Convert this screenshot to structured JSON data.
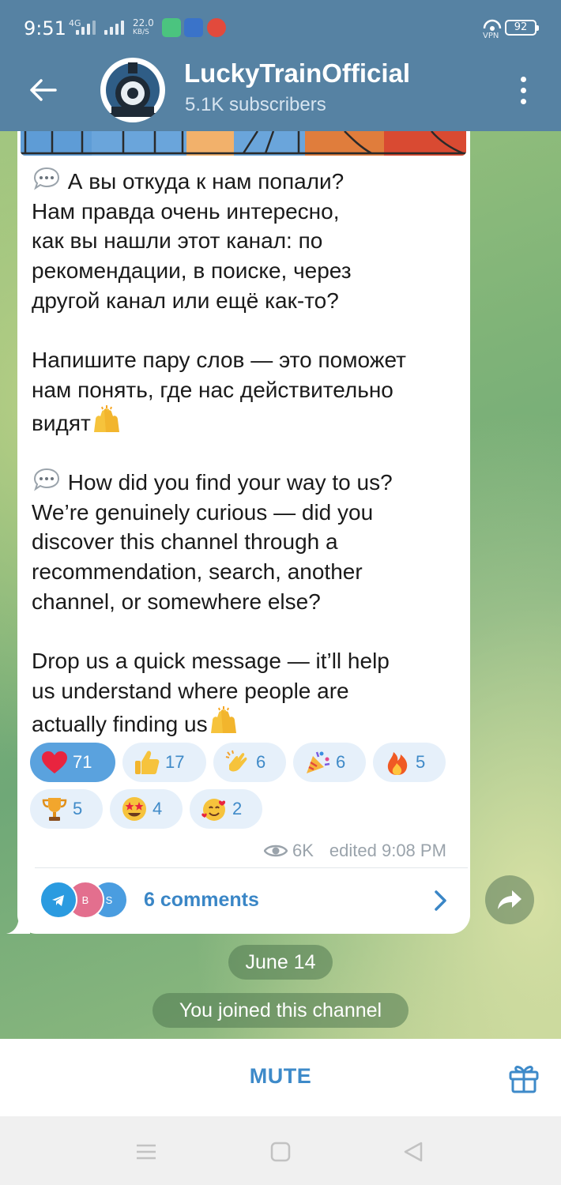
{
  "status_bar": {
    "time": "9:51",
    "network_type": "4G",
    "speed_value": "22.0",
    "speed_unit": "KB/S",
    "vpn_label": "VPN",
    "battery": "92"
  },
  "header": {
    "title": "LuckyTrainOfficial",
    "subtitle": "5.1K subscribers",
    "color": "#5682a3"
  },
  "message": {
    "paragraph_1": "А вы откуда к нам попали?\nНам правда очень интересно,\nкак вы нашли этот канал: по\nрекомендации, в поиске, через\nдругой канал или ещё как-то?",
    "paragraph_2": "Напишите пару слов — это поможет\nнам понять, где нас действительно\nвидят",
    "paragraph_3": "How did you find your way to us?\nWe’re genuinely curious — did you\ndiscover this channel through a\nrecommendation, search, another\nchannel, or somewhere else?",
    "paragraph_4": "Drop us a quick message — it’ll help\nus understand where people are\nactually finding us",
    "reactions": [
      {
        "icon": "heart",
        "count": "71",
        "active": true
      },
      {
        "icon": "thumbs-up",
        "count": "17"
      },
      {
        "icon": "clapping-hands",
        "count": "6"
      },
      {
        "icon": "party-popper",
        "count": "6"
      },
      {
        "icon": "fire",
        "count": "5"
      },
      {
        "icon": "trophy",
        "count": "5"
      },
      {
        "icon": "star-struck",
        "count": "4"
      },
      {
        "icon": "smiling-face-with-hearts",
        "count": "2"
      }
    ],
    "views": "6K",
    "edited": "edited 9:08 PM",
    "comments": {
      "label": "6 comments",
      "avatars": [
        {
          "letter": "",
          "color": "#2b9be0"
        },
        {
          "letter": "B",
          "color": "#e36f8e"
        },
        {
          "letter": "S",
          "color": "#4a9de0"
        }
      ]
    }
  },
  "date_separator": "June 14",
  "service_message": "You joined this channel",
  "bottom_bar": {
    "mute_label": "MUTE"
  }
}
